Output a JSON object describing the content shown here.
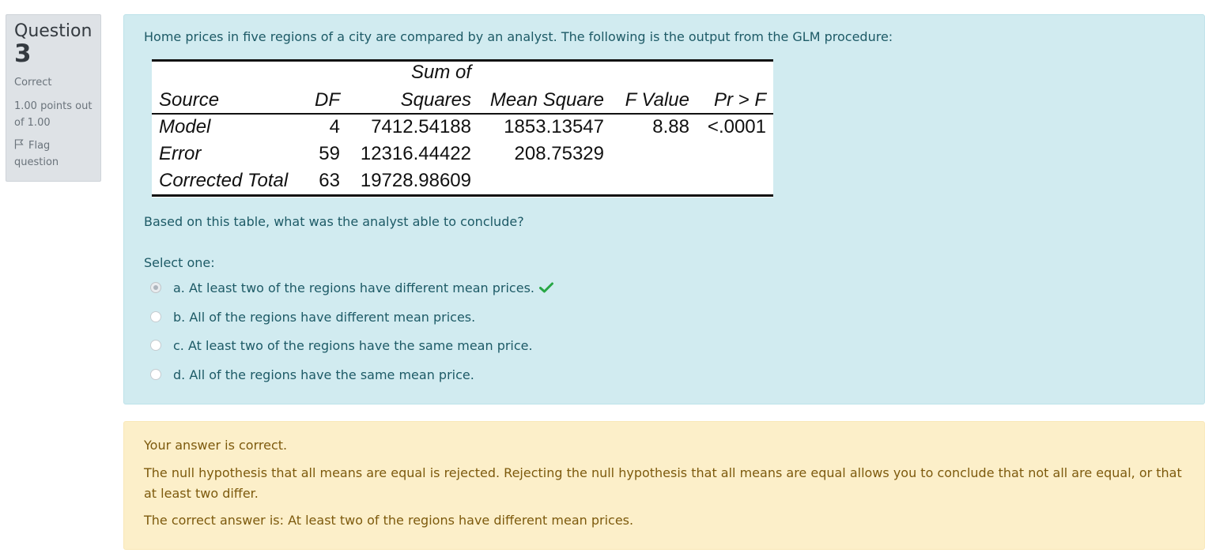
{
  "question": {
    "word": "Question",
    "number": "3",
    "state": "Correct",
    "grade": "1.00 points out of 1.00",
    "flag_label": "Flag question"
  },
  "formulation": {
    "text": "Home prices in five regions of a city are compared by an analyst. The following is the output from the GLM procedure:",
    "table": {
      "header_top": "Sum of",
      "headers": [
        "Source",
        "DF",
        "Squares",
        "Mean Square",
        "F Value",
        "Pr > F"
      ],
      "rows": [
        [
          "Model",
          "4",
          "7412.54188",
          "1853.13547",
          "8.88",
          "<.0001"
        ],
        [
          "Error",
          "59",
          "12316.44422",
          "208.75329",
          "",
          ""
        ],
        [
          "Corrected Total",
          "63",
          "19728.98609",
          "",
          "",
          ""
        ]
      ]
    },
    "prompt": "Based on this table, what was the analyst able to conclude?",
    "select_one": "Select one:",
    "options": [
      {
        "label": "a. At least two of the regions have different mean prices.",
        "selected": true,
        "correct": true
      },
      {
        "label": "b. All of the regions have different mean prices.",
        "selected": false
      },
      {
        "label": "c. At least two of the regions have the same mean price.",
        "selected": false
      },
      {
        "label": "d. All of the regions have the same mean price.",
        "selected": false
      }
    ]
  },
  "feedback": {
    "specific": "Your answer is correct.",
    "general": "The null hypothesis that all means are equal is rejected. Rejecting the null hypothesis that all means are equal allows you to conclude that not all are equal, or that at least two differ.",
    "right_answer": "The correct answer is: At least two of the regions have different mean prices."
  },
  "colors": {
    "formulation_bg": "#d1ebf0",
    "feedback_bg": "#fcefc9",
    "info_bg": "#dee2e6",
    "check_green": "#28a745"
  }
}
